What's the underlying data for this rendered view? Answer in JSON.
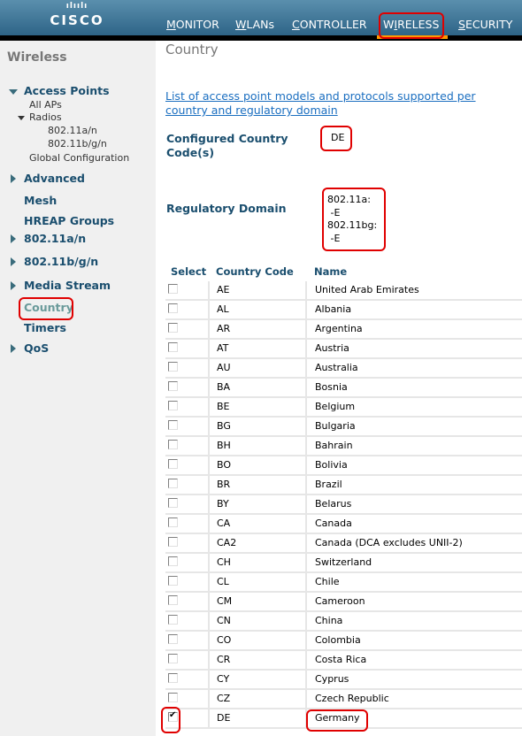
{
  "brand": {
    "logo_bars": "ılıılı",
    "logo_word": "CISCO"
  },
  "nav": {
    "items": [
      {
        "label": "MONITOR",
        "accesskey": "M",
        "rest": "ONITOR"
      },
      {
        "label": "WLANs",
        "accesskey": "W",
        "rest": "LANs"
      },
      {
        "label": "CONTROLLER",
        "accesskey": "C",
        "rest": "ONTROLLER"
      },
      {
        "label": "WIRELESS",
        "pre": "W",
        "accesskey": "I",
        "rest": "RELESS",
        "active": true
      },
      {
        "label": "SECURITY",
        "accesskey": "S",
        "rest": "ECURITY"
      }
    ],
    "active_color": "#ff9900"
  },
  "sidebar": {
    "title": "Wireless",
    "access_points": {
      "label": "Access Points",
      "all_aps": "All APs",
      "radios": "Radios",
      "radio_items": [
        "802.11a/n",
        "802.11b/g/n"
      ],
      "global_config": "Global Configuration"
    },
    "items": [
      {
        "label": "Advanced",
        "expandable": true
      },
      {
        "label": "Mesh",
        "expandable": false
      },
      {
        "label": "HREAP Groups",
        "expandable": false
      },
      {
        "label": "802.11a/n",
        "expandable": true
      },
      {
        "label": "802.11b/g/n",
        "expandable": true
      },
      {
        "label": "Media Stream",
        "expandable": true
      },
      {
        "label": "Country",
        "expandable": false,
        "active": true
      },
      {
        "label": "Timers",
        "expandable": false
      },
      {
        "label": "QoS",
        "expandable": true
      }
    ]
  },
  "main": {
    "title": "Country",
    "link": "List of access point models and protocols supported per country and regulatory domain",
    "configured_label": "Configured Country Code(s)",
    "configured_value": "DE",
    "regdomain_label": "Regulatory Domain",
    "regdomain_value": "802.11a:\n -E\n802.11bg:\n -E",
    "table": {
      "headers": [
        "Select",
        "Country Code",
        "Name"
      ],
      "rows": [
        {
          "code": "AE",
          "name": "United Arab Emirates",
          "checked": false
        },
        {
          "code": "AL",
          "name": "Albania",
          "checked": false
        },
        {
          "code": "AR",
          "name": "Argentina",
          "checked": false
        },
        {
          "code": "AT",
          "name": "Austria",
          "checked": false
        },
        {
          "code": "AU",
          "name": "Australia",
          "checked": false
        },
        {
          "code": "BA",
          "name": "Bosnia",
          "checked": false
        },
        {
          "code": "BE",
          "name": "Belgium",
          "checked": false
        },
        {
          "code": "BG",
          "name": "Bulgaria",
          "checked": false
        },
        {
          "code": "BH",
          "name": "Bahrain",
          "checked": false
        },
        {
          "code": "BO",
          "name": "Bolivia",
          "checked": false
        },
        {
          "code": "BR",
          "name": "Brazil",
          "checked": false
        },
        {
          "code": "BY",
          "name": "Belarus",
          "checked": false
        },
        {
          "code": "CA",
          "name": "Canada",
          "checked": false
        },
        {
          "code": "CA2",
          "name": "Canada (DCA excludes UNII-2)",
          "checked": false
        },
        {
          "code": "CH",
          "name": "Switzerland",
          "checked": false
        },
        {
          "code": "CL",
          "name": "Chile",
          "checked": false
        },
        {
          "code": "CM",
          "name": "Cameroon",
          "checked": false
        },
        {
          "code": "CN",
          "name": "China",
          "checked": false
        },
        {
          "code": "CO",
          "name": "Colombia",
          "checked": false
        },
        {
          "code": "CR",
          "name": "Costa Rica",
          "checked": false
        },
        {
          "code": "CY",
          "name": "Cyprus",
          "checked": false
        },
        {
          "code": "CZ",
          "name": "Czech Republic",
          "checked": false
        },
        {
          "code": "DE",
          "name": "Germany",
          "checked": true
        }
      ]
    }
  },
  "annotation_color": "#e00000"
}
